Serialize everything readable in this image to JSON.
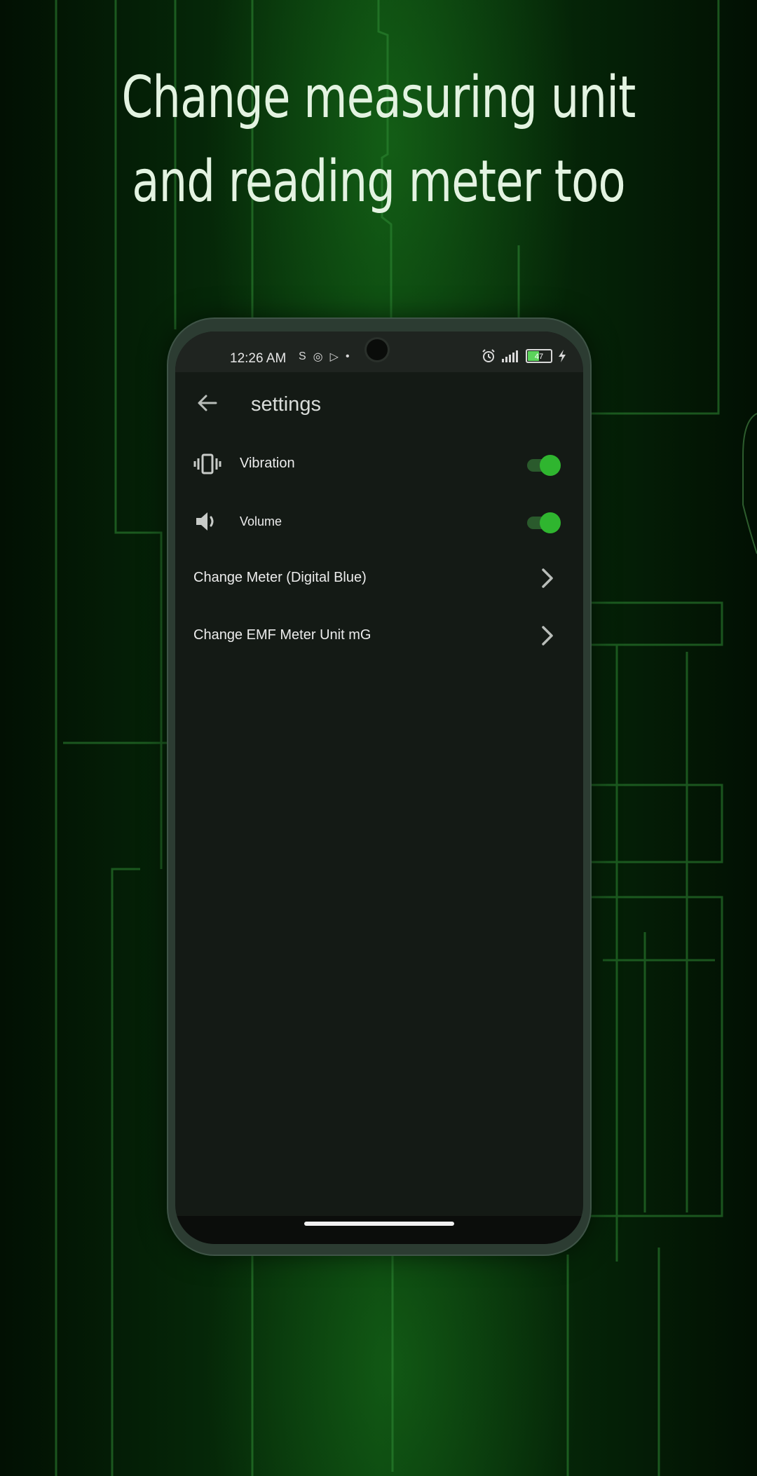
{
  "headline": {
    "line1": "Change measuring unit",
    "line2": "and reading meter too"
  },
  "status_bar": {
    "time": "12:26 AM",
    "battery": "47",
    "icons": [
      "s-icon",
      "instagram-icon",
      "play-icon",
      "dot-icon",
      "alarm-icon",
      "signal-icon",
      "battery-icon",
      "charging-icon"
    ]
  },
  "app_bar": {
    "title": "settings"
  },
  "settings": {
    "vibration": {
      "label": "Vibration",
      "enabled": true
    },
    "volume": {
      "label": "Volume",
      "enabled": true
    },
    "meter": {
      "label": "Change Meter (Digital Blue)"
    },
    "unit": {
      "label": "Change EMF Meter Unit mG"
    }
  },
  "colors": {
    "accent": "#2fb52f",
    "track": "#2a5a2c",
    "screen_bg": "#141a15",
    "headline_text": "#e3f3e1"
  }
}
